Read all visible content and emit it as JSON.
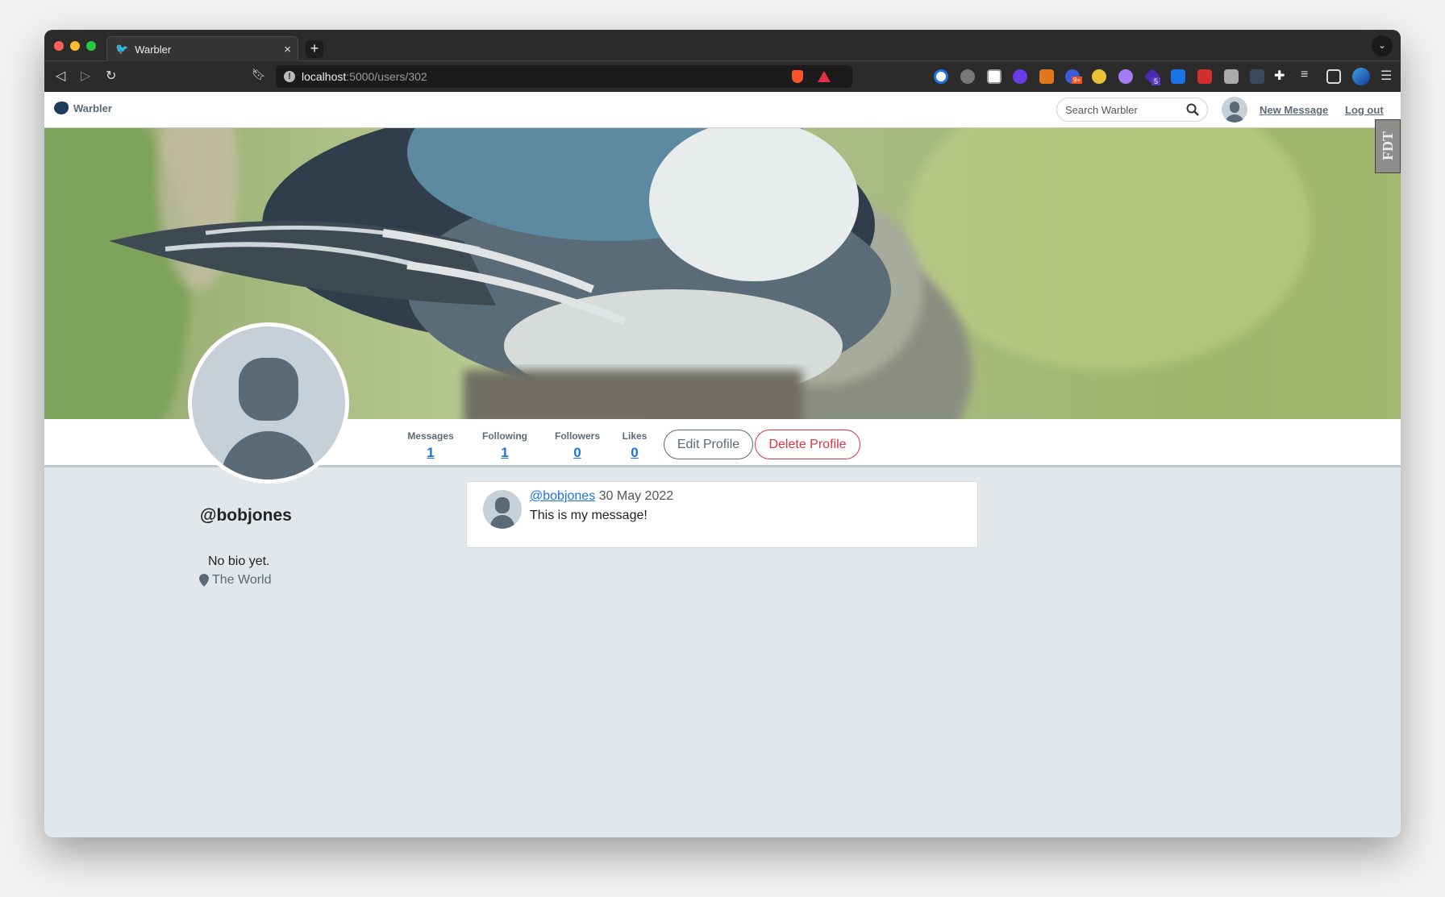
{
  "browser": {
    "tab_title": "Warbler",
    "tab_close": "×",
    "new_tab": "+",
    "url_host": "localhost",
    "url_rest": ":5000/users/302",
    "extension_badges": [
      "9+",
      "5"
    ]
  },
  "navbar": {
    "brand": "Warbler",
    "search_placeholder": "Search Warbler",
    "new_message": "New Message",
    "logout": "Log out"
  },
  "devtools_tab": "FDT",
  "profile": {
    "username": "@bobjones",
    "bio": "No bio yet.",
    "location": "The World",
    "stats": [
      {
        "label": "Messages",
        "value": "1"
      },
      {
        "label": "Following",
        "value": "1"
      },
      {
        "label": "Followers",
        "value": "0"
      },
      {
        "label": "Likes",
        "value": "0"
      }
    ],
    "edit_button": "Edit Profile",
    "delete_button": "Delete Profile"
  },
  "messages": [
    {
      "user": "@bobjones",
      "date": "30 May 2022",
      "text": "This is my message!"
    }
  ],
  "colors": {
    "link": "#1a73e8",
    "danger": "#dc3545",
    "muted": "#5a6a77",
    "page_bg": "#e1e7eb"
  }
}
